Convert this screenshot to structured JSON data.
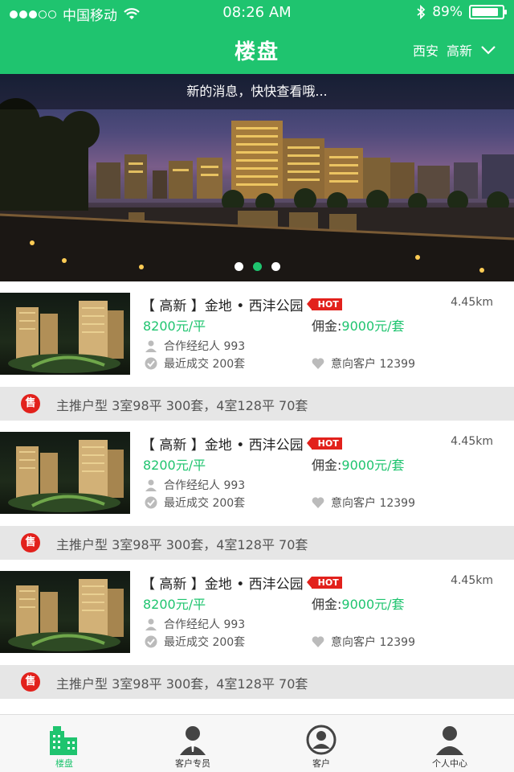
{
  "status_bar": {
    "carrier": "中国移动",
    "time": "08:26 AM",
    "battery": "89%",
    "battery_level": 0.89
  },
  "nav": {
    "title": "楼盘",
    "city": "西安",
    "district": "高新"
  },
  "banner": {
    "message": "新的消息，快快查看哦...",
    "page_count": 3,
    "active_page": 2
  },
  "listings": [
    {
      "name": "【 高新 】金地 • 西沣公园",
      "hot_label": "HOT",
      "distance": "4.45km",
      "price": "8200元/平",
      "commission_label": "佣金:",
      "commission_value": "9000元/套",
      "agents": "合作经纪人 993",
      "recent_deals": "最近成交 200套",
      "interested": "意向客户 12399",
      "promo_badge": "售",
      "promo_text": "主推户型 3室98平 300套，4室128平 70套"
    },
    {
      "name": "【 高新 】金地 • 西沣公园",
      "hot_label": "HOT",
      "distance": "4.45km",
      "price": "8200元/平",
      "commission_label": "佣金:",
      "commission_value": "9000元/套",
      "agents": "合作经纪人 993",
      "recent_deals": "最近成交 200套",
      "interested": "意向客户 12399",
      "promo_badge": "售",
      "promo_text": "主推户型 3室98平 300套，4室128平 70套"
    },
    {
      "name": "【 高新 】金地 • 西沣公园",
      "hot_label": "HOT",
      "distance": "4.45km",
      "price": "8200元/平",
      "commission_label": "佣金:",
      "commission_value": "9000元/套",
      "agents": "合作经纪人 993",
      "recent_deals": "最近成交 200套",
      "interested": "意向客户 12399",
      "promo_badge": "售",
      "promo_text": "主推户型 3室98平 300套，4室128平 70套"
    }
  ],
  "tabs": [
    {
      "label": "楼盘",
      "icon": "buildings-icon",
      "active": true
    },
    {
      "label": "客户专员",
      "icon": "agent-icon",
      "active": false
    },
    {
      "label": "客户",
      "icon": "client-icon",
      "active": false
    },
    {
      "label": "个人中心",
      "icon": "person-icon",
      "active": false
    }
  ],
  "colors": {
    "brand": "#1fc46f",
    "hot": "#e2211c",
    "promo_bg": "#e6e6e6"
  }
}
